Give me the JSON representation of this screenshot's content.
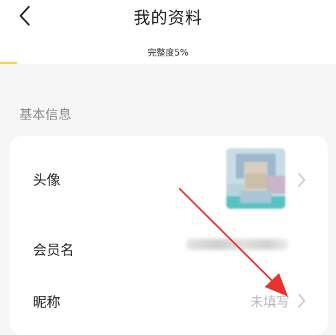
{
  "header": {
    "title": "我的资料",
    "completeness_label": "完整度5%",
    "completeness_progress": 0.05
  },
  "section": {
    "title": "基本信息"
  },
  "rows": [
    {
      "label": "头像",
      "value": ""
    },
    {
      "label": "会员名",
      "value": ""
    },
    {
      "label": "昵称",
      "value": "未填写"
    }
  ],
  "colors": {
    "accent": "#f7d63a",
    "annotation_arrow": "#e8332b"
  },
  "icons": {
    "back": "chevron-left-icon",
    "row_arrow": "chevron-right-icon"
  }
}
